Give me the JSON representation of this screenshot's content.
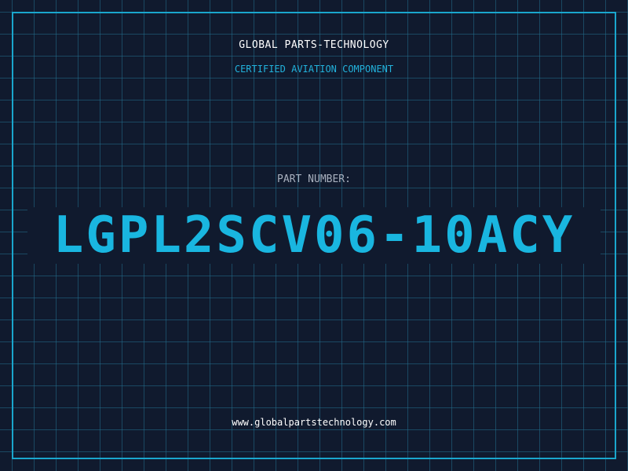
{
  "header": {
    "company": "GLOBAL PARTS-TECHNOLOGY",
    "subtitle": "CERTIFIED AVIATION COMPONENT"
  },
  "part": {
    "label": "PART NUMBER:",
    "number": "LGPL2SCV06-10ACY"
  },
  "footer": {
    "website": "www.globalpartstechnology.com"
  },
  "colors": {
    "background": "#101a2e",
    "grid": "#236e8c",
    "accent": "#19b6e0",
    "text": "#ffffff",
    "muted": "#a7afbd"
  }
}
